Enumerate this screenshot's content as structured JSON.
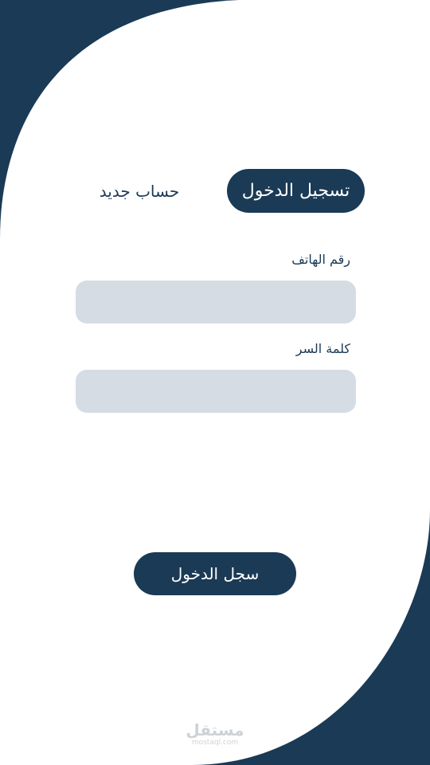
{
  "colors": {
    "primary": "#1a3a56",
    "background": "#ffffff",
    "input_fill": "#d5dce3"
  },
  "tabs": {
    "login": "تسجيل الدخول",
    "register": "حساب جديد",
    "active": "login"
  },
  "form": {
    "phone_label": "رقم الهاتف",
    "phone_value": "",
    "password_label": "كلمة السر",
    "password_value": ""
  },
  "submit": {
    "label": "سجل الدخول"
  },
  "watermark": {
    "logo_text": "مستقل",
    "url": "mostaql.com"
  }
}
